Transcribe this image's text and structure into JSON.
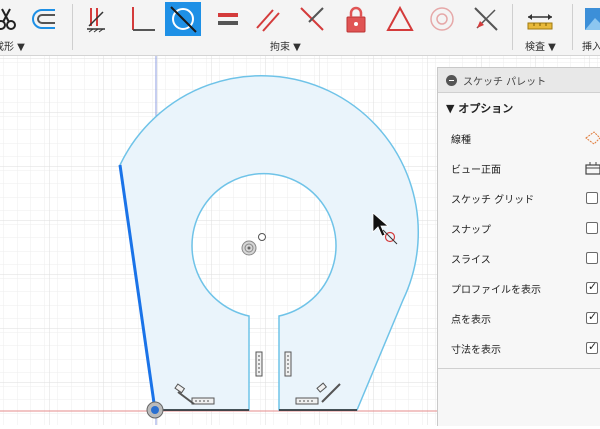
{
  "toolbar": {
    "groups": [
      {
        "label": "成形 ▼",
        "name": "create"
      },
      {
        "label": "拘束 ▼",
        "name": "constraints"
      },
      {
        "label": "検査 ▼",
        "name": "inspect"
      },
      {
        "label": "挿入 ▼",
        "name": "insert"
      }
    ],
    "constraint_tools": [
      {
        "icon": "coincident-icon"
      },
      {
        "icon": "collinear-icon"
      },
      {
        "icon": "concentric-icon"
      },
      {
        "icon": "midpoint-icon"
      },
      {
        "icon": "fix-unfix-icon"
      },
      {
        "icon": "parallel-icon"
      },
      {
        "icon": "perpendicular-icon"
      },
      {
        "icon": "horizontal-vertical-icon"
      },
      {
        "icon": "tangent-icon"
      },
      {
        "icon": "smooth-icon"
      },
      {
        "icon": "symmetry-icon"
      }
    ],
    "active_tool": "tangent-icon",
    "active_color": "#1e90e6"
  },
  "palette": {
    "title": "スケッチ パレット",
    "section": "▼ オプション",
    "rows": [
      {
        "label": "線種",
        "control": "icon",
        "icon": "linetype-icon"
      },
      {
        "label": "ビュー正面",
        "control": "icon",
        "icon": "look-at-icon"
      },
      {
        "label": "スケッチ グリッド",
        "control": "checkbox",
        "checked": false
      },
      {
        "label": "スナップ",
        "control": "checkbox",
        "checked": false
      },
      {
        "label": "スライス",
        "control": "checkbox",
        "checked": false
      },
      {
        "label": "プロファイルを表示",
        "control": "checkbox",
        "checked": true
      },
      {
        "label": "点を表示",
        "control": "checkbox",
        "checked": true
      },
      {
        "label": "寸法を表示",
        "control": "checkbox",
        "checked": true
      }
    ]
  },
  "sketch": {
    "profile_fill": "#eaf4fb",
    "profile_stroke": "#6fc3e8",
    "selected_line_color": "#1a73e8",
    "axis_red": "#e58b8b",
    "axis_blue": "#8c9ee0"
  }
}
